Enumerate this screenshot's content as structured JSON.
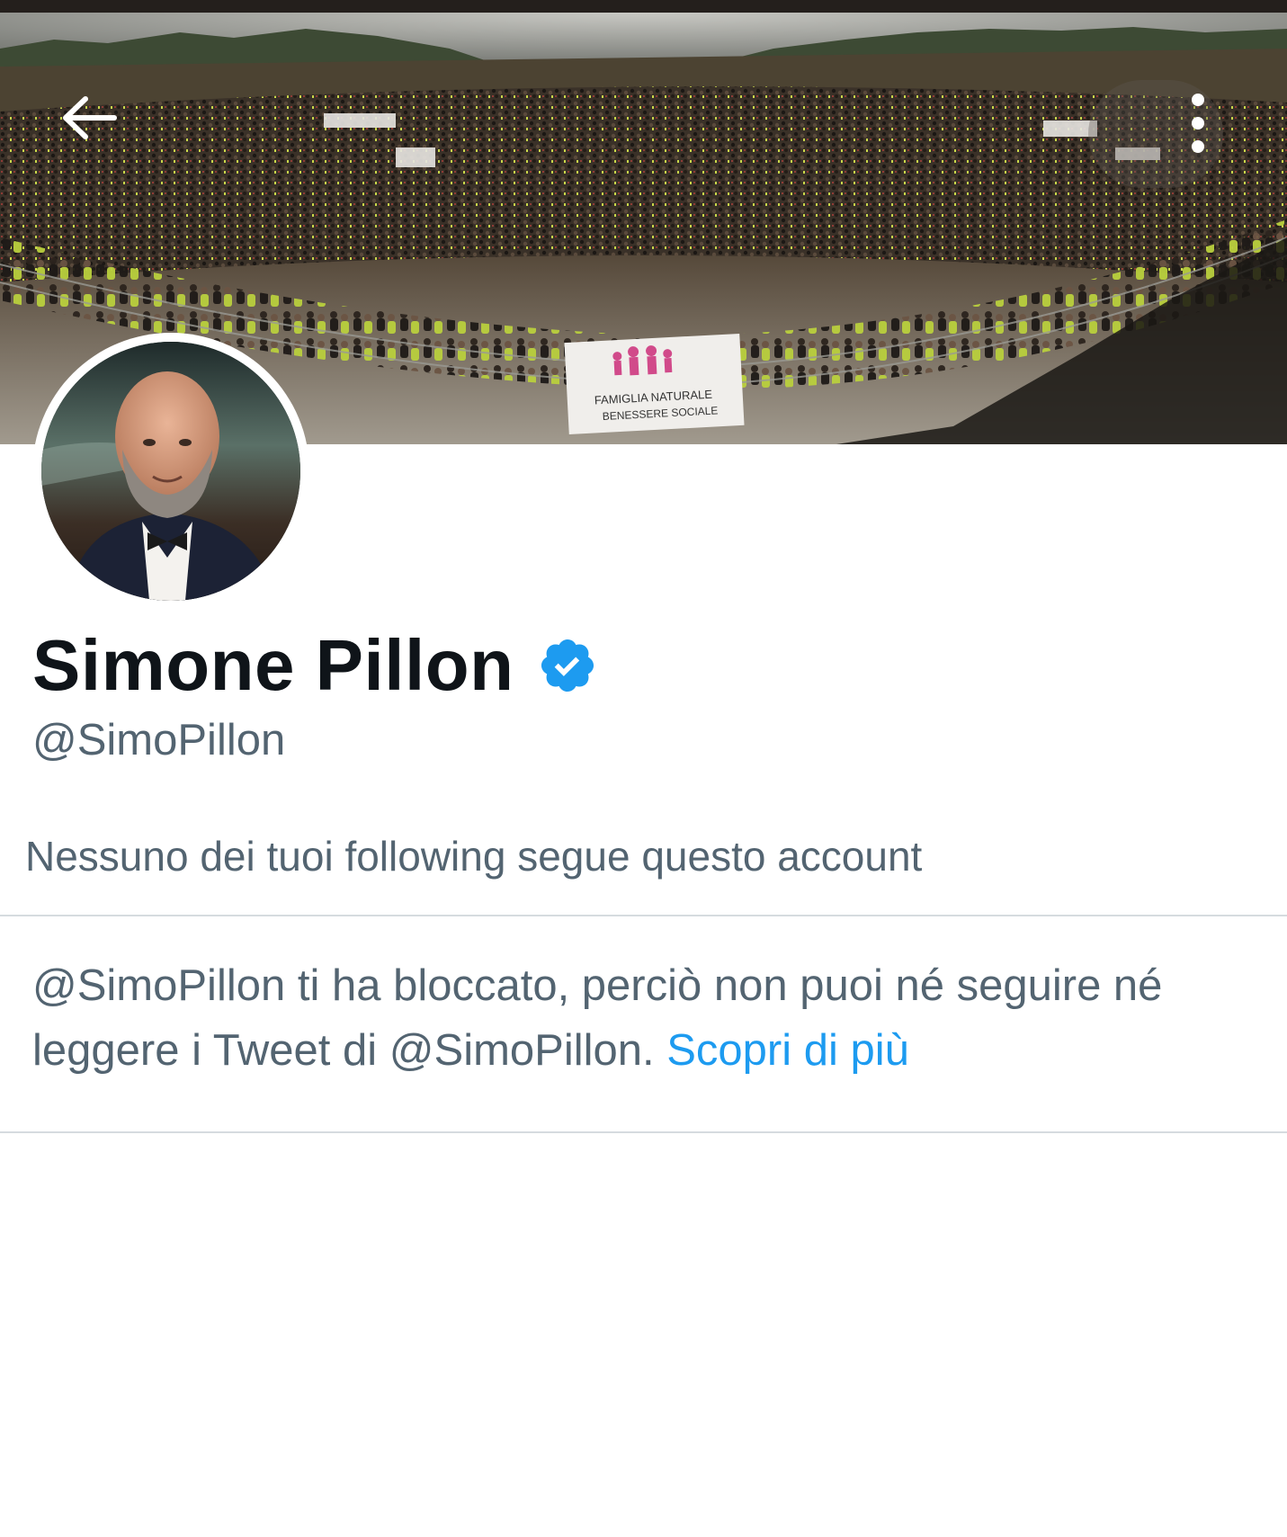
{
  "header": {
    "back_icon": "arrow-left-icon",
    "more_icon": "vertical-ellipsis-icon",
    "banner_sign_text": [
      "FAMIGLIA NATURALE",
      "BENESSERE SOCIALE"
    ]
  },
  "profile": {
    "display_name": "Simone Pillon",
    "verified_icon": "verified-badge-icon",
    "handle": "@SimoPillon",
    "followers_you_know": "Nessuno dei tuoi following segue questo account"
  },
  "blocked_notice": {
    "message": "@SimoPillon ti ha bloccato, perciò non puoi né seguire né leggere i Tweet di @SimoPillon.",
    "learn_more_label": "Scopri di più"
  },
  "colors": {
    "text_primary": "#0f1419",
    "text_secondary": "#536471",
    "accent": "#1d9bf0",
    "divider": "#d6dbdf",
    "top_strip": "#241f1c"
  }
}
